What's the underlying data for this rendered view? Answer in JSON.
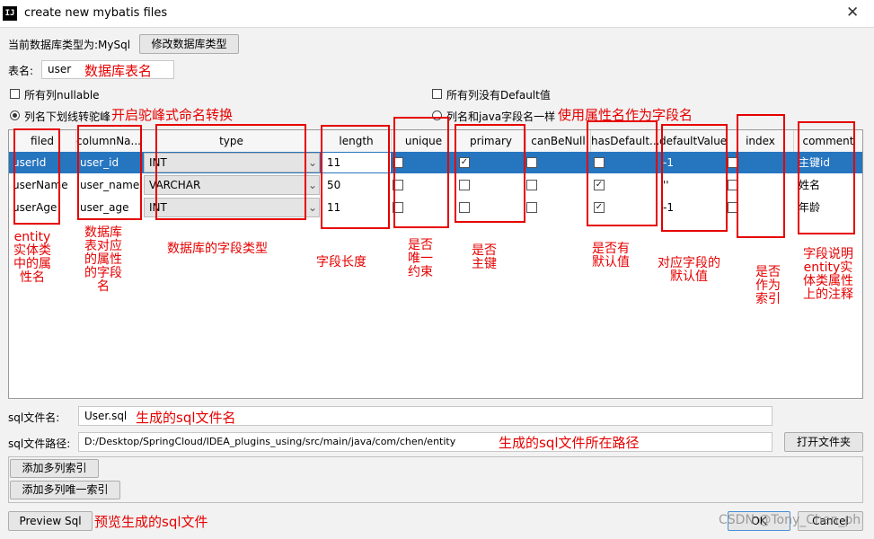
{
  "window": {
    "title": "create new mybatis files",
    "app_icon": "IJ"
  },
  "db": {
    "type_label": "当前数据库类型为:MySql",
    "change_button": "修改数据库类型"
  },
  "table_name": {
    "label": "表名:",
    "value": "user",
    "annotation": "数据库表名"
  },
  "options": {
    "all_nullable": "所有列nullable",
    "no_default": "所有列没有Default值",
    "camel_case": "列名下划线转驼峰",
    "camel_annotation": "开启驼峰式命名转换",
    "same_as_java": "列名和java字段名一样",
    "same_annotation": "使用属性名作为字段名"
  },
  "columns": [
    "filed",
    "columnNa...",
    "type",
    "length",
    "unique",
    "primary",
    "canBeNull",
    "hasDefault...",
    "defaultValue",
    "index",
    "comment"
  ],
  "rows": [
    {
      "filed": "userId",
      "column": "user_id",
      "type": "INT",
      "length": "11",
      "unique": false,
      "primary": true,
      "canBeNull": false,
      "hasDefault": false,
      "defaultValue": "-1",
      "index": false,
      "comment": "主键id"
    },
    {
      "filed": "userName",
      "column": "user_name",
      "type": "VARCHAR",
      "length": "50",
      "unique": false,
      "primary": false,
      "canBeNull": false,
      "hasDefault": true,
      "defaultValue": "''",
      "index": false,
      "comment": "姓名"
    },
    {
      "filed": "userAge",
      "column": "user_age",
      "type": "INT",
      "length": "11",
      "unique": false,
      "primary": false,
      "canBeNull": false,
      "hasDefault": true,
      "defaultValue": "-1",
      "index": false,
      "comment": "年龄"
    }
  ],
  "annotations": {
    "filed": "entity\n实体类\n中的属\n性名",
    "column": "数据库\n表对应\n的属性\n的字段\n名",
    "type": "数据库的字段类型",
    "length": "字段长度",
    "unique": "是否\n唯一\n约束",
    "primary": "是否\n主键",
    "hasDefault": "是否有\n默认值",
    "defaultValue": "对应字段的\n默认值",
    "index": "是否\n作为\n索引",
    "comment": "字段说明\nentity实\n体类属性\n上的注释"
  },
  "sql_file": {
    "name_label": "sql文件名:",
    "name_value": "User.sql",
    "name_annotation": "生成的sql文件名",
    "path_label": "sql文件路径:",
    "path_value": "D:/Desktop/SpringCloud/IDEA_plugins_using/src/main/java/com/chen/entity",
    "path_annotation": "生成的sql文件所在路径",
    "open_folder": "打开文件夹"
  },
  "index_buttons": {
    "add_multi_index": "添加多列索引",
    "add_multi_unique": "添加多列唯一索引"
  },
  "footer": {
    "preview": "Preview Sql",
    "preview_annotation": "预览生成的sql文件",
    "ok": "OK",
    "cancel": "Cancel",
    "watermark": "CSDN @Tony_Chen_ph"
  },
  "colors": {
    "selection": "#2675bf",
    "annotation_red": "#e60000"
  },
  "icons": {
    "checked": "check-icon",
    "dropdown": "chevron-down-icon",
    "close": "close-icon"
  }
}
